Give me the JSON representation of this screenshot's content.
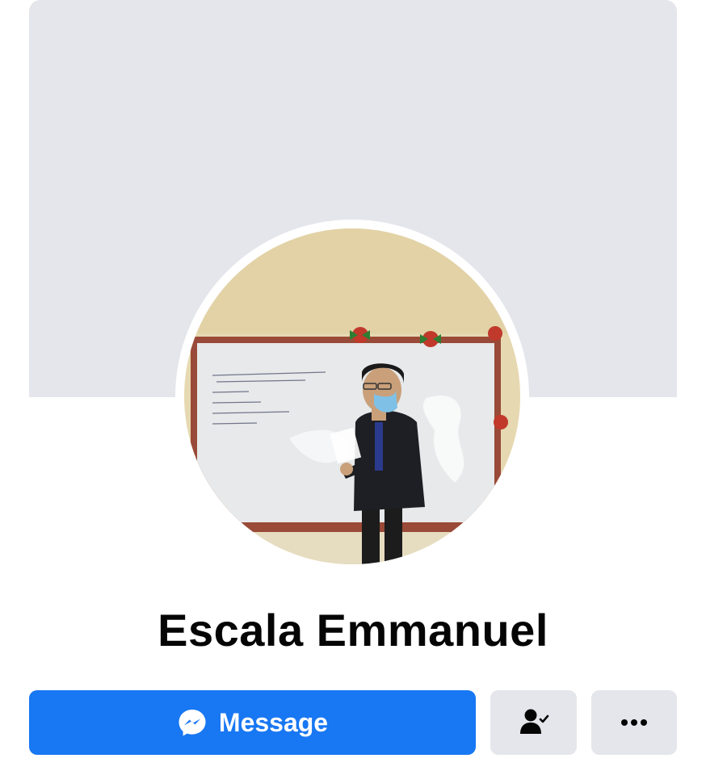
{
  "profile": {
    "name": "Escala Emmanuel"
  },
  "actions": {
    "message_label": "Message"
  },
  "icons": {
    "message": "messenger-icon",
    "friends": "friends-check-icon",
    "more": "more-dots-icon"
  },
  "colors": {
    "primary": "#1877f2",
    "secondary_button": "#e4e6eb",
    "cover": "#e4e6eb",
    "text": "#050505"
  }
}
